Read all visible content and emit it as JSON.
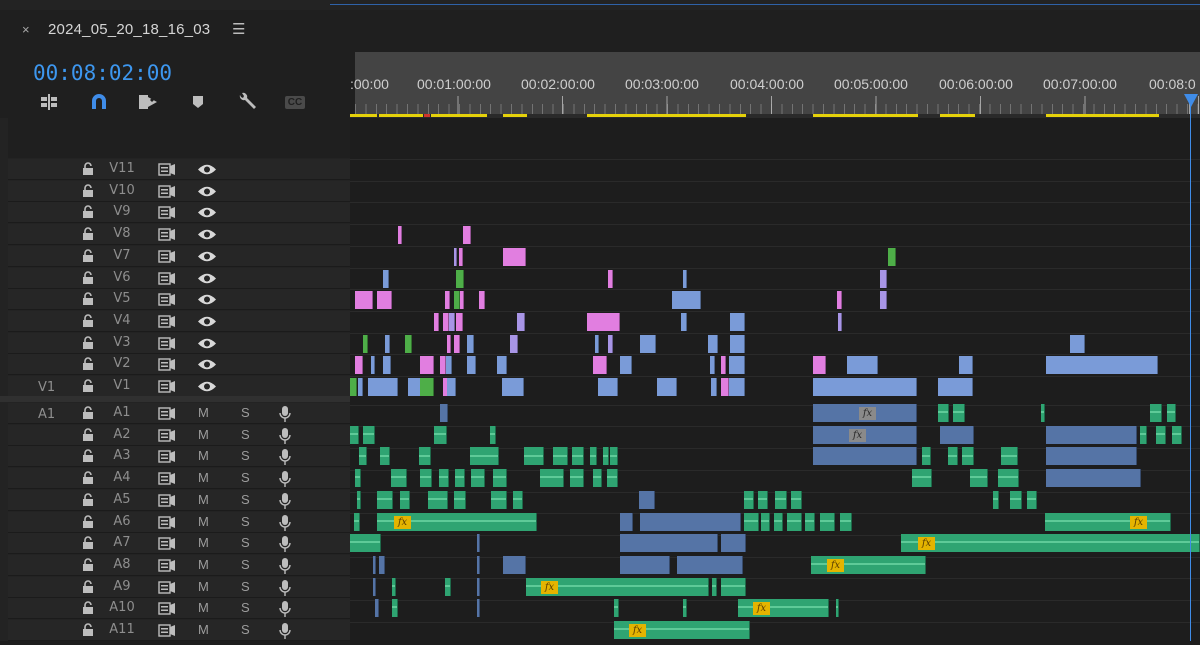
{
  "sequence": {
    "name": "2024_05_20_18_16_03",
    "close_glyph": "×",
    "menu_glyph": "☰",
    "timecode": "00:08:02:00"
  },
  "toolbar": {
    "icons": [
      "insert-sequence-as-nest-icon",
      "snap-magnet-icon",
      "linked-selection-icon",
      "add-marker-icon",
      "timeline-settings-wrench-icon",
      "captions-cc-icon"
    ],
    "cc_label": "CC"
  },
  "ruler": {
    "labels": [
      ":00:00",
      "00:01:00:00",
      "00:02:00:00",
      "00:03:00:00",
      "00:04:00:00",
      "00:05:00:00",
      "00:06:00:00",
      "00:07:00:00",
      "00:08:0"
    ]
  },
  "colors": {
    "timecode": "#3d97ef",
    "video_clip": "#7a9bd8",
    "pink_clip": "#e17ee0",
    "green_clip": "#4eae48",
    "audio_clip": "#2fa472",
    "fx_badge": "#e4b400",
    "playhead": "#3f8ce8",
    "work_area": "#e5d10a"
  },
  "video_tracks": [
    "V11",
    "V10",
    "V9",
    "V8",
    "V7",
    "V6",
    "V5",
    "V4",
    "V3",
    "V2",
    "V1"
  ],
  "audio_tracks": [
    "A1",
    "A2",
    "A3",
    "A4",
    "A5",
    "A6",
    "A7",
    "A8",
    "A9",
    "A10",
    "A11"
  ],
  "source_patch": {
    "video": "V1",
    "audio": "A1"
  },
  "audio_toggles": {
    "mute": "M",
    "solo": "S"
  },
  "fx_label": "fx"
}
